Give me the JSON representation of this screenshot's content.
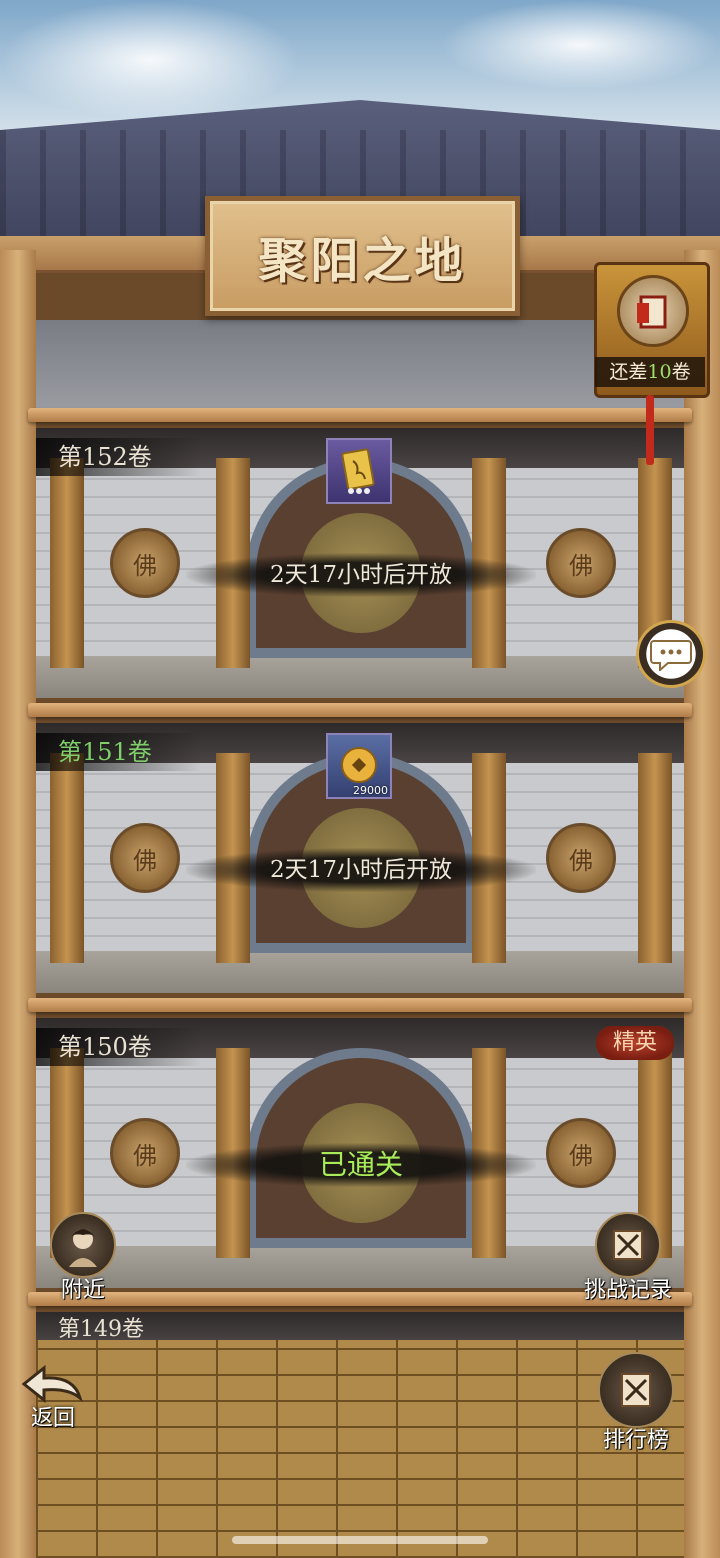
{
  "header": {
    "title": "聚阳之地"
  },
  "lantern": {
    "prefix": "还差",
    "count": "10",
    "suffix": "卷"
  },
  "rooms": [
    {
      "label": "第152卷",
      "status": "2天17小时后开放",
      "reward_icon": "scroll-card-icon",
      "reward_qty": ""
    },
    {
      "label": "第151卷",
      "status": "2天17小时后开放",
      "reward_icon": "copper-coin-icon",
      "reward_qty": "29000"
    },
    {
      "label": "第150卷",
      "status": "已通关",
      "badge": "精英"
    }
  ],
  "peek_label": "第149卷",
  "medal_glyph": "佛",
  "buttons": {
    "nearby": "附近",
    "challenge_log": "挑战记录",
    "back": "返回",
    "ranking": "排行榜"
  },
  "colors": {
    "green_text": "#7fd06a",
    "cleared_text": "#a8ec5a",
    "accent_gold": "#d2a64e"
  }
}
